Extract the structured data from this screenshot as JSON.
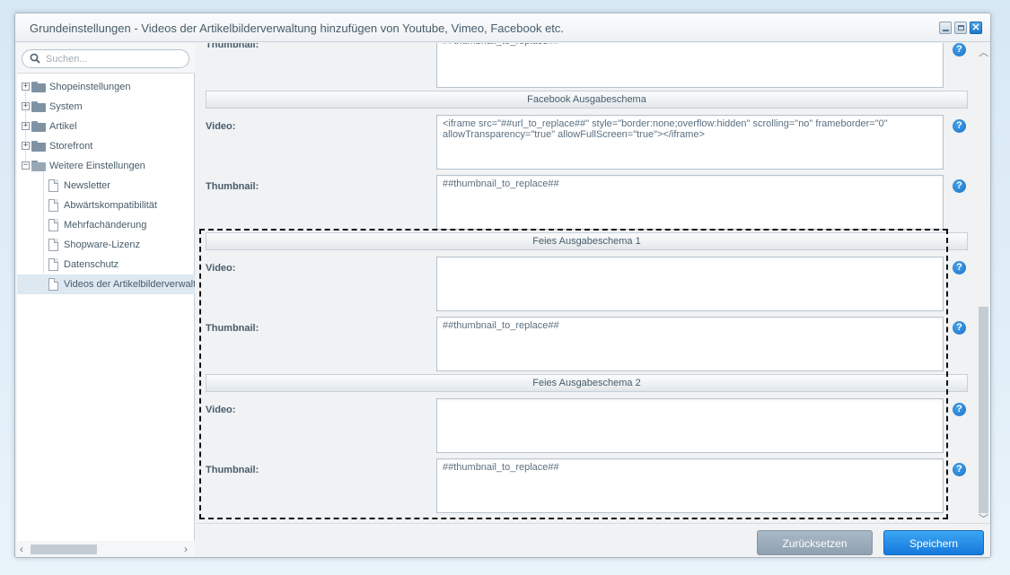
{
  "window": {
    "title": "Grundeinstellungen - Videos der Artikelbilderverwaltung hinzufügen von Youtube, Vimeo, Facebook etc.",
    "controls": {
      "minimize": "",
      "maximize": "",
      "close": "✕"
    }
  },
  "sidebar": {
    "search_placeholder": "Suchen...",
    "tree": [
      {
        "label": "Shopeinstellungen",
        "type": "folder",
        "expander": "+"
      },
      {
        "label": "System",
        "type": "folder",
        "expander": "+"
      },
      {
        "label": "Artikel",
        "type": "folder",
        "expander": "+"
      },
      {
        "label": "Storefront",
        "type": "folder",
        "expander": "+"
      },
      {
        "label": "Weitere Einstellungen",
        "type": "folder",
        "expander": "−"
      },
      {
        "label": "Newsletter",
        "type": "doc"
      },
      {
        "label": "Abwärtskompatibilität",
        "type": "doc"
      },
      {
        "label": "Mehrfachänderung",
        "type": "doc"
      },
      {
        "label": "Shopware-Lizenz",
        "type": "doc"
      },
      {
        "label": "Datenschutz",
        "type": "doc"
      },
      {
        "label": "Videos der Artikelbilderverwaltung",
        "type": "doc",
        "selected": true
      }
    ],
    "scroll_left": "‹",
    "scroll_right": "›"
  },
  "form": {
    "top_partial": {
      "label": "Thumbnail:",
      "value": "##thumbnail_to_replace##"
    },
    "sections": [
      {
        "title": "Facebook Ausgabeschema",
        "video_label": "Video:",
        "video_value": "<iframe src=\"##url_to_replace##\" style=\"border:none;overflow:hidden\" scrolling=\"no\" frameborder=\"0\" allowTransparency=\"true\" allowFullScreen=\"true\"></iframe>",
        "thumb_label": "Thumbnail:",
        "thumb_value": "##thumbnail_to_replace##"
      },
      {
        "title": "Feies Ausgabeschema 1",
        "video_label": "Video:",
        "video_value": "",
        "thumb_label": "Thumbnail:",
        "thumb_value": "##thumbnail_to_replace##"
      },
      {
        "title": "Feies Ausgabeschema 2",
        "video_label": "Video:",
        "video_value": "",
        "thumb_label": "Thumbnail:",
        "thumb_value": "##thumbnail_to_replace##"
      }
    ],
    "help_glyph": "?"
  },
  "footer": {
    "reset_label": "Zurücksetzen",
    "save_label": "Speichern"
  },
  "colors": {
    "accent": "#1679dc",
    "help_icon": "#1773c8",
    "selection": "#dde8f1"
  }
}
